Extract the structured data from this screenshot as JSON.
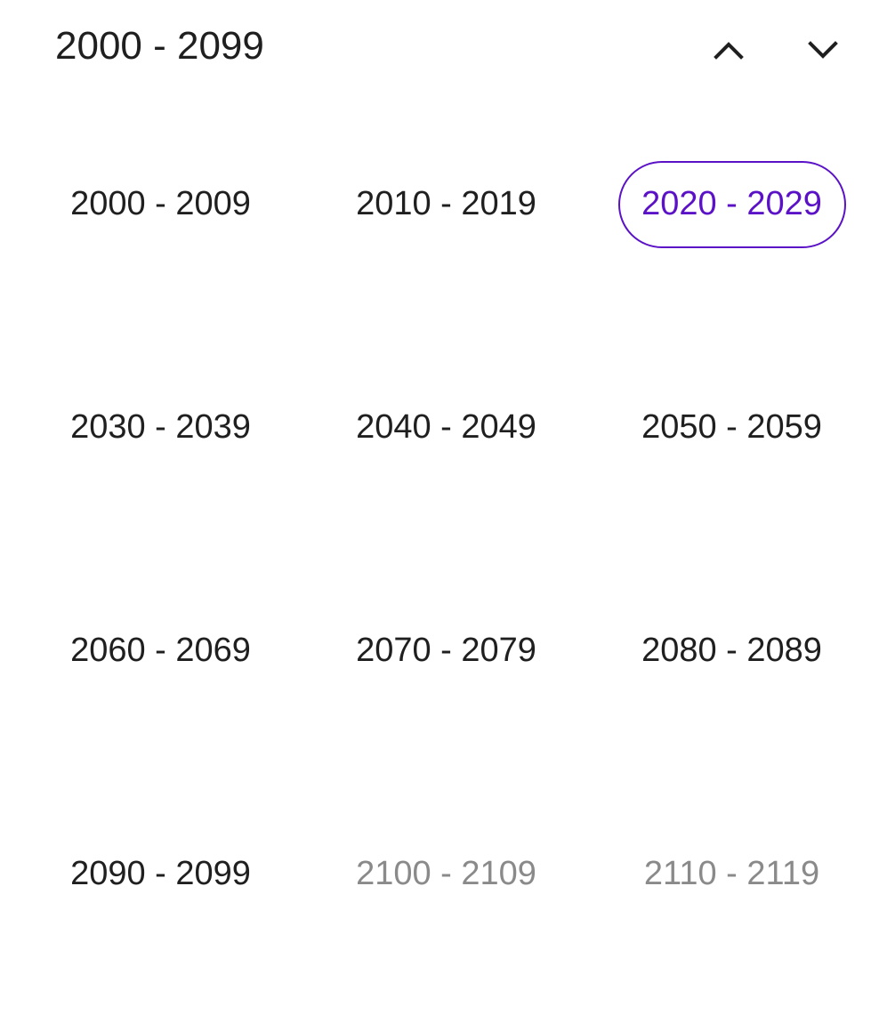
{
  "header": {
    "title": "2000 - 2099",
    "prev_icon": "chevron-up-icon",
    "next_icon": "chevron-down-icon"
  },
  "colors": {
    "text": "#1f1f1f",
    "accent": "#5b12c6",
    "disabled": "#8a8a8a"
  },
  "decades": [
    {
      "label": "2000 - 2009",
      "state": "normal"
    },
    {
      "label": "2010 - 2019",
      "state": "normal"
    },
    {
      "label": "2020 - 2029",
      "state": "selected"
    },
    {
      "label": "2030 - 2039",
      "state": "normal"
    },
    {
      "label": "2040 - 2049",
      "state": "normal"
    },
    {
      "label": "2050 - 2059",
      "state": "normal"
    },
    {
      "label": "2060 - 2069",
      "state": "normal"
    },
    {
      "label": "2070 - 2079",
      "state": "normal"
    },
    {
      "label": "2080 - 2089",
      "state": "normal"
    },
    {
      "label": "2090 - 2099",
      "state": "normal"
    },
    {
      "label": "2100 - 2109",
      "state": "disabled"
    },
    {
      "label": "2110 - 2119",
      "state": "disabled"
    }
  ]
}
